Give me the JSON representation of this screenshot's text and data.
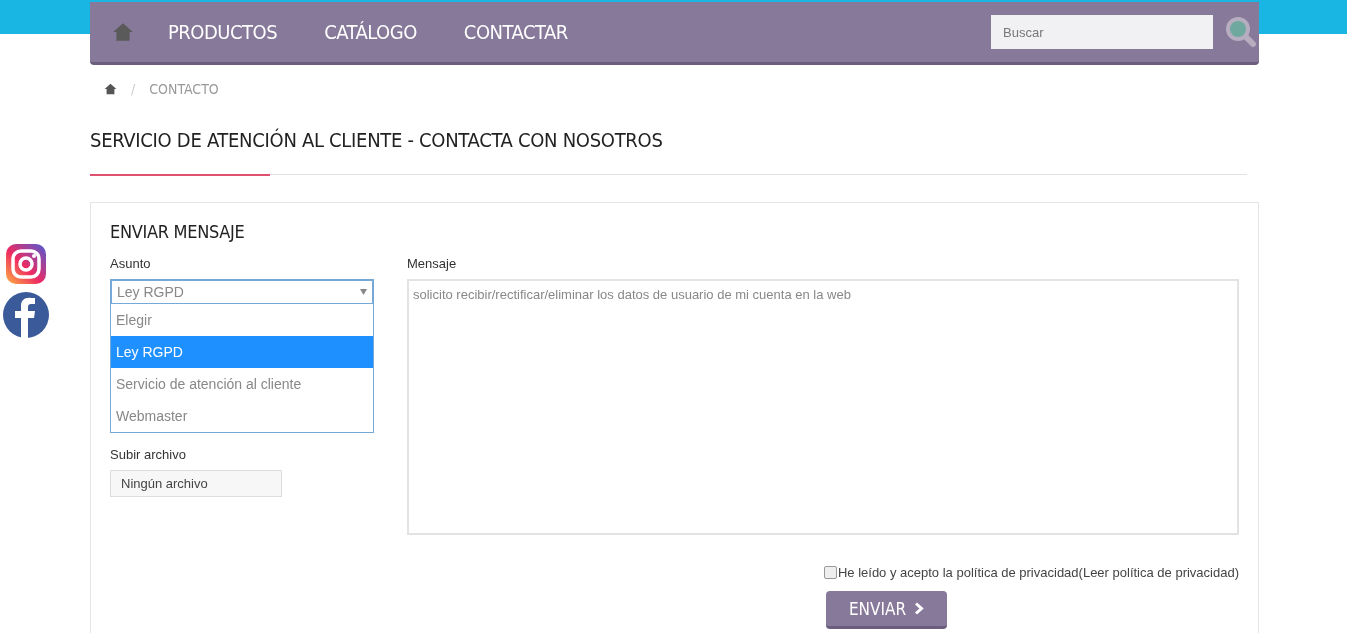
{
  "nav": {
    "items": [
      {
        "label": "PRODUCTOS"
      },
      {
        "label": "CATÁLOGO"
      },
      {
        "label": "CONTACTAR"
      }
    ],
    "search": {
      "placeholder": "Buscar"
    }
  },
  "breadcrumb": {
    "separator": "/",
    "items": [
      "CONTACTO"
    ]
  },
  "page_title": "SERVICIO DE ATENCIÓN AL CLIENTE - CONTACTA CON NOSOTROS",
  "form": {
    "title": "ENVIAR MENSAJE",
    "subject": {
      "label": "Asunto",
      "value": "Ley RGPD",
      "expanded": true,
      "options": [
        {
          "label": "Elegir",
          "selected": false
        },
        {
          "label": "Ley RGPD",
          "selected": true
        },
        {
          "label": "Servicio de atención al cliente",
          "selected": false
        },
        {
          "label": "Webmaster",
          "selected": false
        }
      ]
    },
    "upload": {
      "label": "Subir archivo",
      "value": "Ningún archivo"
    },
    "message": {
      "label": "Mensaje",
      "placeholder": "solicito recibir/rectificar/eliminar los datos de usuario de mi cuenta en la web"
    },
    "privacy": {
      "label": "He leído y acepto la política de privacidad(Leer política de privacidad)",
      "checked": false
    },
    "submit": {
      "label": "ENVIAR"
    }
  }
}
